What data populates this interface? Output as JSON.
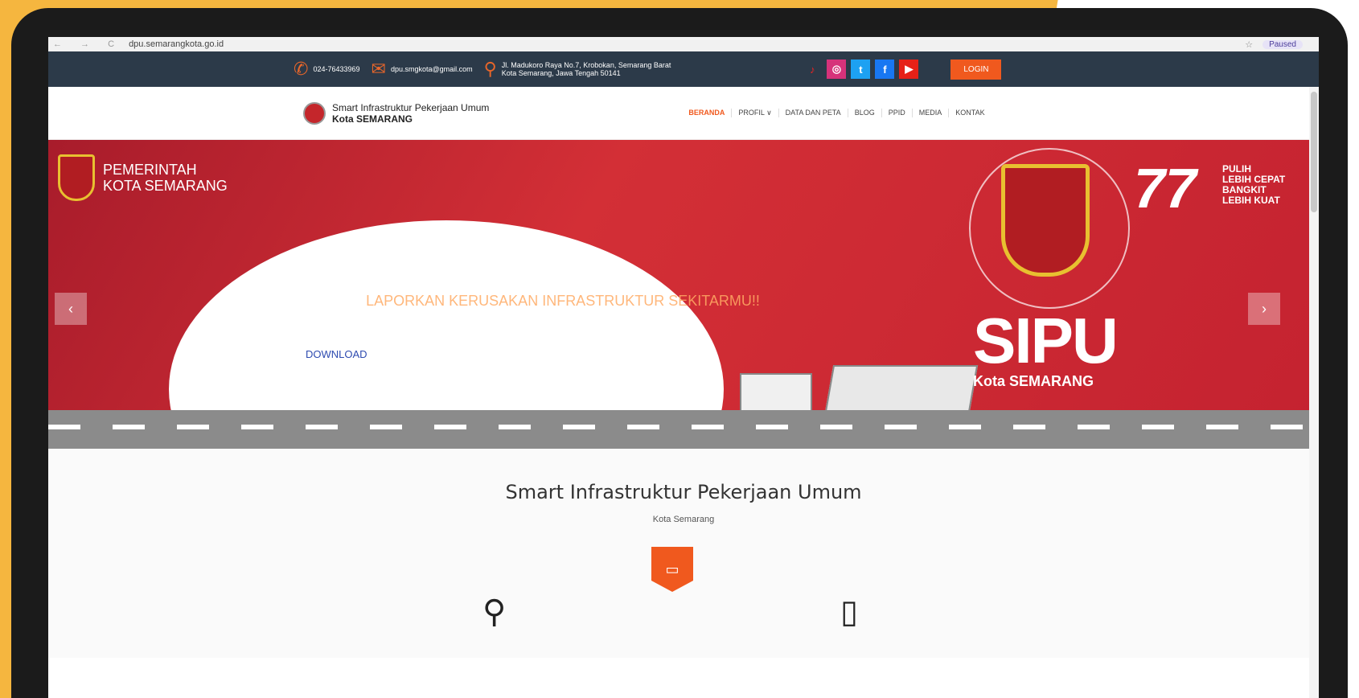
{
  "browser": {
    "nav_icons": "← → C",
    "url": "dpu.semarangkota.go.id",
    "profile_label": "Paused"
  },
  "topbar": {
    "phone": "024-76433969",
    "email": "dpu.smgkota@gmail.com",
    "address_line1": "Jl. Madukoro Raya No.7, Krobokan, Semarang Barat",
    "address_line2": "Kota Semarang, Jawa Tengah 50141",
    "social": [
      "tiktok",
      "instagram",
      "twitter",
      "facebook",
      "youtube"
    ],
    "login_label": "LOGIN"
  },
  "navbar": {
    "brand_line1": "Smart Infrastruktur Pekerjaan Umum",
    "brand_line2": "Kota SEMARANG",
    "menu": [
      "BERANDA",
      "PROFIL ∨",
      "DATA DAN PETA",
      "BLOG",
      "PPID",
      "MEDIA",
      "KONTAK"
    ]
  },
  "banner": {
    "pemkot_line1": "PEMERINTAH",
    "pemkot_line2": "KOTA SEMARANG",
    "overlay_title": "LAPORKAN KERUSAKAN INFRASTRUKTUR SEKITARMU!!",
    "download_label": "DOWNLOAD",
    "sipu": "SIPU",
    "sipu_sub": "Kota SEMARANG",
    "seventy": "77",
    "tagline_1": "PULIH",
    "tagline_2": "LEBIH CEPAT",
    "tagline_3": "BANGKIT",
    "tagline_4": "LEBIH KUAT",
    "prev": "‹",
    "next": "›"
  },
  "section": {
    "title": "Smart Infrastruktur Pekerjaan Umum",
    "subtitle": "Kota Semarang"
  },
  "colors": {
    "accent": "#f0591e",
    "topbar": "#2c3a49",
    "banner": "#c8232f",
    "frame": "#f5b63f"
  }
}
